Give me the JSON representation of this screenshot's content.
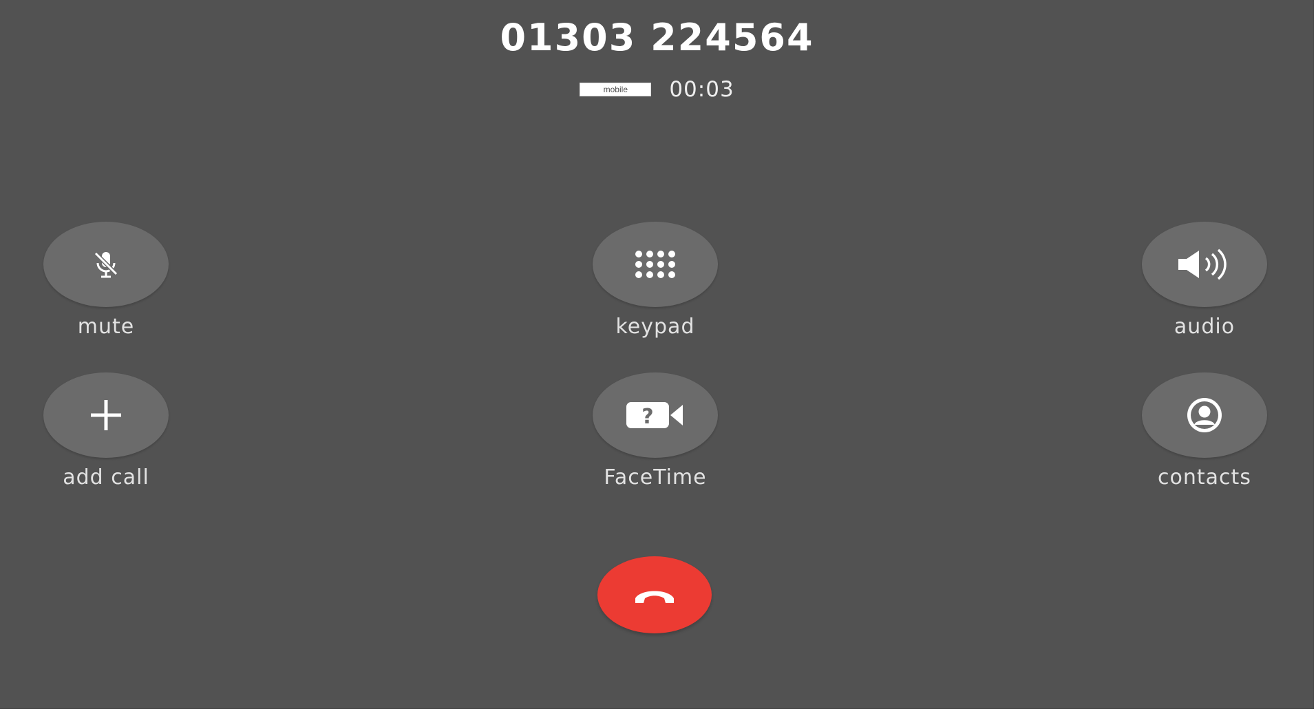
{
  "call": {
    "phone_number": "01303 224564",
    "number_type": "mobile",
    "duration": "00:03"
  },
  "controls": {
    "mute": {
      "label": "mute",
      "icon": "muted-microphone-icon"
    },
    "keypad": {
      "label": "keypad",
      "icon": "keypad-grid-icon"
    },
    "audio": {
      "label": "audio",
      "icon": "speaker-icon"
    },
    "add_call": {
      "label": "add call",
      "icon": "plus-icon"
    },
    "facetime": {
      "label": "FaceTime",
      "icon": "video-camera-question-icon"
    },
    "contacts": {
      "label": "contacts",
      "icon": "person-circle-icon"
    }
  },
  "end_call": {
    "icon": "hang-up-phone-icon"
  },
  "colors": {
    "background": "#525252",
    "button": "#6b6b6b",
    "end_call": "#ec3b33",
    "text": "#ffffff"
  }
}
